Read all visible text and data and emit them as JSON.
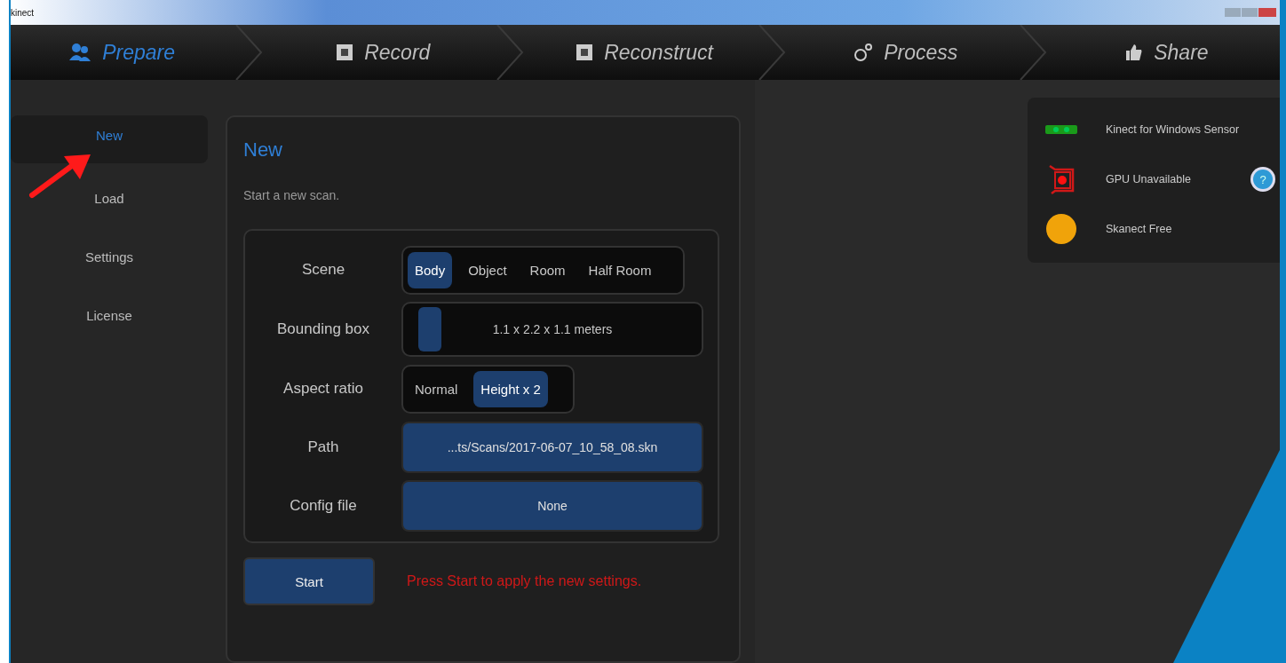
{
  "window": {
    "title": "kinect"
  },
  "steps": [
    {
      "label": "Prepare",
      "kind": "people",
      "selected": true
    },
    {
      "label": "Record",
      "kind": "square",
      "selected": false
    },
    {
      "label": "Reconstruct",
      "kind": "square",
      "selected": false
    },
    {
      "label": "Process",
      "kind": "circles",
      "selected": false
    },
    {
      "label": "Share",
      "kind": "thumb",
      "selected": false
    }
  ],
  "sidebar": {
    "items": [
      {
        "label": "New",
        "selected": true
      },
      {
        "label": "Load",
        "selected": false
      },
      {
        "label": "Settings",
        "selected": false
      },
      {
        "label": "License",
        "selected": false
      }
    ]
  },
  "panel": {
    "title": "New",
    "description": "Start a new scan.",
    "settings": [
      {
        "kind": "segmented",
        "label": "Scene",
        "options": [
          {
            "label": "Body",
            "selected": true
          },
          {
            "label": "Object",
            "selected": false
          },
          {
            "label": "Room",
            "selected": false
          },
          {
            "label": "Half Room",
            "selected": false
          }
        ]
      },
      {
        "kind": "slider",
        "label": "Bounding box",
        "level": 0.05,
        "value": "1.1 x 2.2 x 1.1 meters"
      },
      {
        "kind": "segmented",
        "label": "Aspect ratio",
        "options": [
          {
            "label": "Normal",
            "selected": false
          },
          {
            "label": "Height x 2",
            "selected": true
          }
        ]
      },
      {
        "kind": "button",
        "label": "Path",
        "value": "...ts/Scans/2017-06-07_10_58_08.skn"
      },
      {
        "kind": "button",
        "label": "Config file",
        "value": "None"
      }
    ],
    "start_button": "Start",
    "message": "Press Start to apply the new settings."
  },
  "status": [
    {
      "kind": "sensor",
      "label": "Kinect for Windows Sensor"
    },
    {
      "kind": "gpu",
      "label": "GPU Unavailable",
      "help_icon": "?"
    },
    {
      "kind": "license",
      "label": "Skanect Free"
    }
  ]
}
